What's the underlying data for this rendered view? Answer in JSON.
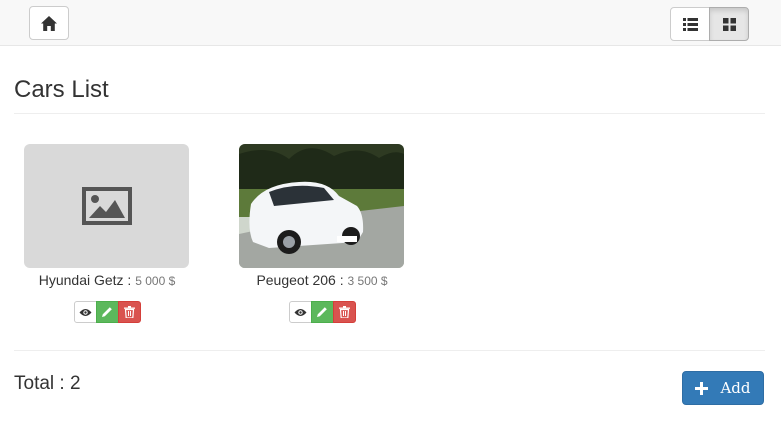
{
  "nav": {
    "home_icon": "home-icon",
    "view_list_icon": "list-icon",
    "view_grid_icon": "grid-icon",
    "active_view": "grid"
  },
  "page": {
    "title": "Cars List"
  },
  "cars": [
    {
      "name": "Hyundai Getz",
      "separator": " : ",
      "price": "5 000 $",
      "image": "placeholder-image-icon"
    },
    {
      "name": "Peugeot 206",
      "separator": " : ",
      "price": "3 500 $",
      "image": "photo"
    }
  ],
  "footer": {
    "total_label": "Total : 2",
    "add_label": "Add",
    "add_icon": "plus-icon"
  },
  "colors": {
    "primary": "#337ab7",
    "success": "#5cb85c",
    "danger": "#d9534f",
    "navbar_bg": "#f8f8f8"
  }
}
